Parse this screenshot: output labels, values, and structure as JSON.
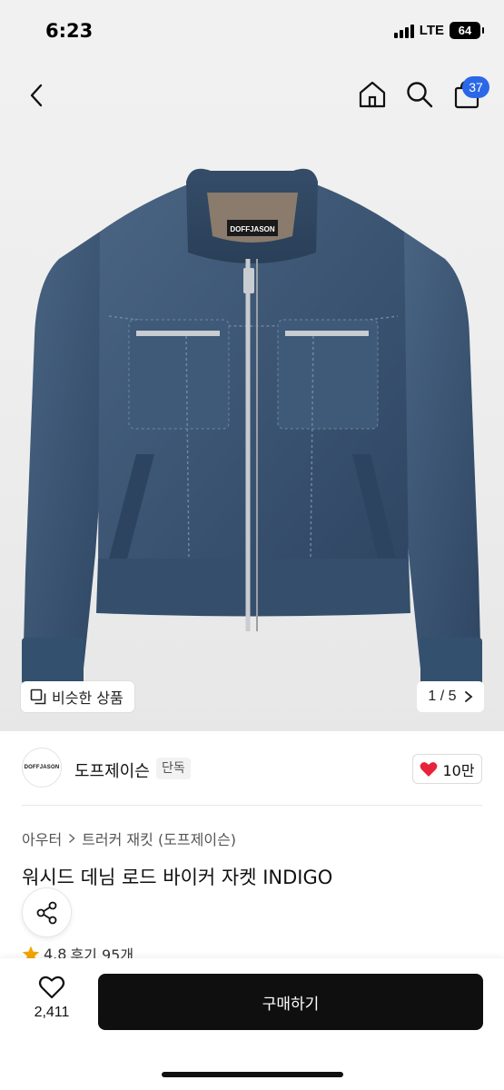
{
  "status_bar": {
    "time": "6:23",
    "network": "LTE",
    "battery": "64"
  },
  "nav": {
    "back_icon": "chevron-left-icon",
    "home_icon": "home-icon",
    "search_icon": "search-icon",
    "cart_icon": "shopping-bag-icon",
    "cart_count": "37"
  },
  "image": {
    "brand_label": "DOFFJASON",
    "similar_label": "비슷한 상품",
    "pager": "1 / 5"
  },
  "brand": {
    "logo_text": "DOFFJASON",
    "name": "도프제이슨",
    "tag": "단독",
    "likes": "10만"
  },
  "product": {
    "breadcrumb": [
      "아우터",
      "트러커 재킷 (도프제이슨)"
    ],
    "title": "워시드 데님 로드 바이커 자켓 INDIGO",
    "rating": "4.8",
    "reviews": "후기 95개"
  },
  "bottom": {
    "wish_count": "2,411",
    "buy_label": "구매하기"
  },
  "colors": {
    "accent": "#2b68e6",
    "heart": "#e8223a",
    "star": "#f4a300",
    "buy": "#0f0f0f"
  }
}
